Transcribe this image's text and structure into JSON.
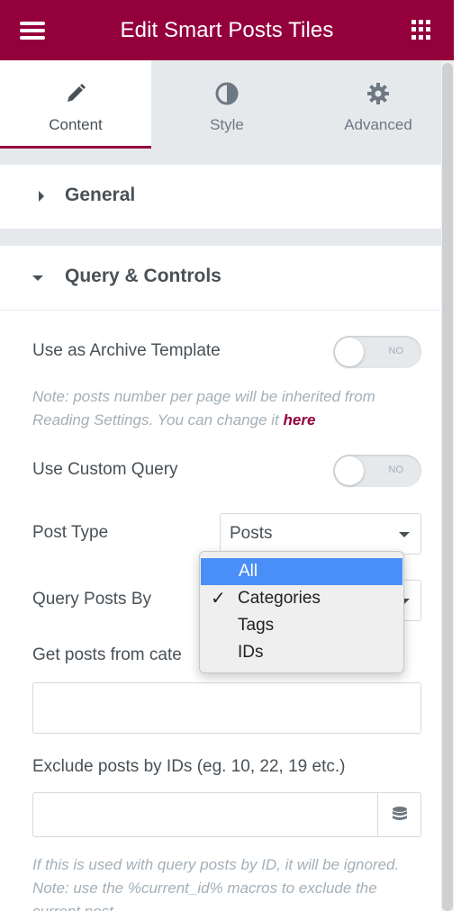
{
  "header": {
    "title": "Edit Smart Posts Tiles",
    "menu_icon": "hamburger-icon",
    "apps_icon": "grid-icon"
  },
  "tabs": [
    {
      "label": "Content",
      "icon": "pencil-icon",
      "active": true
    },
    {
      "label": "Style",
      "icon": "half-circle-icon",
      "active": false
    },
    {
      "label": "Advanced",
      "icon": "gear-icon",
      "active": false
    }
  ],
  "sections": {
    "general": {
      "title": "General",
      "expanded": false
    },
    "query": {
      "title": "Query & Controls",
      "expanded": true
    }
  },
  "controls": {
    "archive_template": {
      "label": "Use as Archive Template",
      "toggle_text": "NO"
    },
    "note": {
      "text": "Note: posts number per page will be inherited from Reading Settings. You can change it",
      "link": "here"
    },
    "custom_query": {
      "label": "Use Custom Query",
      "toggle_text": "NO"
    },
    "post_type": {
      "label": "Post Type",
      "value": "Posts"
    },
    "query_by": {
      "label": "Query Posts By"
    },
    "get_from": {
      "label": "Get posts from cate"
    },
    "exclude": {
      "label": "Exclude posts by IDs (eg. 10, 22, 19 etc.)"
    },
    "bottom_note": "If this is used with query posts by ID, it will be ignored. Note: use the %current_id% macros to exclude the current post"
  },
  "dropdown": {
    "options": [
      "All",
      "Categories",
      "Tags",
      "IDs"
    ],
    "highlighted": "All",
    "checked": "Categories",
    "check_mark": "✓"
  },
  "colors": {
    "brand": "#93003c",
    "highlight": "#4a8ff7"
  }
}
